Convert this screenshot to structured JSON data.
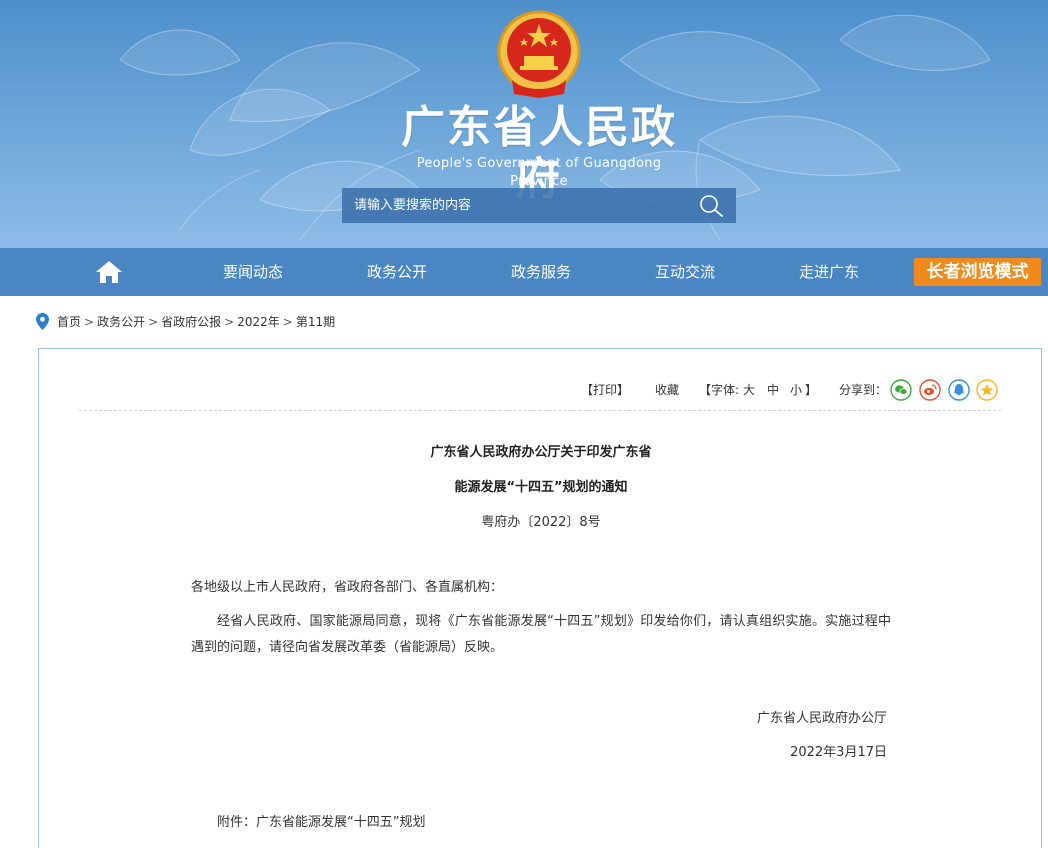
{
  "header": {
    "title": "广东省人民政府",
    "subtitle": "People's Government of Guangdong Province",
    "search_placeholder": "请输入要搜索的内容"
  },
  "nav": {
    "items": [
      "要闻动态",
      "政务公开",
      "政务服务",
      "互动交流",
      "走进广东"
    ],
    "elder_mode": "长者浏览模式",
    "home_icon": "home-icon"
  },
  "breadcrumb": {
    "items": [
      "首页",
      "政务公开",
      "省政府公报",
      "2022年",
      "第11期"
    ],
    "separator": ">"
  },
  "toolbar": {
    "print": "【打印】",
    "favorite": "收藏",
    "font_open": "【字体:",
    "font_large": "大",
    "font_medium": "中",
    "font_small": "小",
    "font_close": "】",
    "share_label": "分享到：",
    "share_icons": [
      "wechat-icon",
      "weibo-icon",
      "qq-icon",
      "qzone-icon"
    ]
  },
  "article": {
    "title_line1": "广东省人民政府办公厅关于印发广东省",
    "title_line2": "能源发展“十四五”规划的通知",
    "doc_number": "粤府办〔2022〕8号",
    "addressee": "各地级以上市人民政府，省政府各部门、各直属机构：",
    "body": "经省人民政府、国家能源局同意，现将《广东省能源发展“十四五”规划》印发给你们，请认真组织实施。实施过程中遇到的问题，请径向省发展改革委（省能源局）反映。",
    "signer": "广东省人民政府办公厅",
    "date": "2022年3月17日",
    "attachment": "附件：广东省能源发展“十四五”规划"
  },
  "colors": {
    "banner_top": "#4e8fcb",
    "nav_bg": "#4a86c4",
    "elder_btn": "#f08a1c",
    "panel_border": "#9cc2e5",
    "wechat": "#3dab3d",
    "weibo": "#e6522c",
    "qq": "#3a8fd9",
    "qzone": "#f5b820"
  }
}
